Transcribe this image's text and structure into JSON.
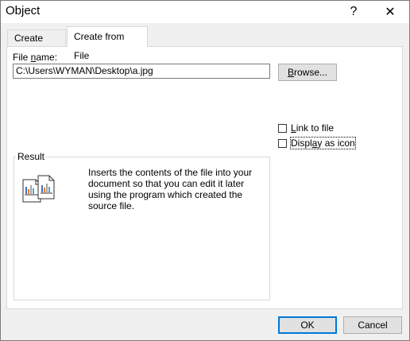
{
  "window": {
    "title": "Object",
    "help_label": "?",
    "close_label": "✕"
  },
  "tabs": [
    {
      "label": "Create New",
      "active": false
    },
    {
      "label": "Create from File",
      "active": true
    }
  ],
  "file_name": {
    "label_before": "File ",
    "label_mnemonic": "n",
    "label_after": "ame:",
    "value": "C:\\Users\\WYMAN\\Desktop\\a.jpg"
  },
  "browse": {
    "mnemonic": "B",
    "rest": "rowse..."
  },
  "options": {
    "link_to_file": {
      "mnemonic": "L",
      "rest": "ink to file",
      "checked": false
    },
    "display_as_icon": {
      "before": "Displ",
      "mnemonic": "a",
      "rest": "y as icon",
      "checked": false
    }
  },
  "result": {
    "legend": "Result",
    "description": "Inserts the contents of the file into your document so that you can edit it later using the program which created the source file.",
    "icon": "embedded-document-chart-icon"
  },
  "footer": {
    "ok_label": "OK",
    "cancel_label": "Cancel"
  }
}
